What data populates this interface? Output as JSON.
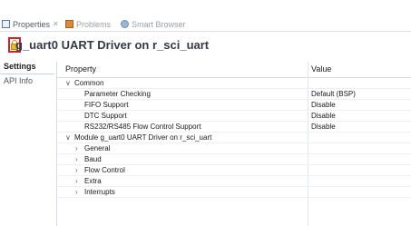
{
  "tabs": [
    {
      "label": "Properties",
      "icon": "properties-icon",
      "close": "✕",
      "active": true
    },
    {
      "label": "Problems",
      "icon": "problems-icon",
      "active": false
    },
    {
      "label": "Smart Browser",
      "icon": "smart-browser-icon",
      "active": false
    }
  ],
  "header": {
    "lock_icon": "lock-icon",
    "title": "g_uart0 UART Driver on r_sci_uart",
    "highlight_color": "#d0222b"
  },
  "side_tabs": [
    {
      "label": "Settings",
      "active": true
    },
    {
      "label": "API Info",
      "active": false
    }
  ],
  "grid": {
    "columns": {
      "property": "Property",
      "value": "Value"
    },
    "rows": [
      {
        "label": "Common",
        "value": "",
        "level": 0,
        "chevron": "∨"
      },
      {
        "label": "Parameter Checking",
        "value": "Default (BSP)",
        "level": 2,
        "chevron": ""
      },
      {
        "label": "FIFO Support",
        "value": "Disable",
        "level": 2,
        "chevron": ""
      },
      {
        "label": "DTC Support",
        "value": "Disable",
        "level": 2,
        "chevron": ""
      },
      {
        "label": "RS232/RS485 Flow Control Support",
        "value": "Disable",
        "level": 2,
        "chevron": ""
      },
      {
        "label": "Module g_uart0 UART Driver on r_sci_uart",
        "value": "",
        "level": 0,
        "chevron": "∨"
      },
      {
        "label": "General",
        "value": "",
        "level": 1,
        "chevron": "›"
      },
      {
        "label": "Baud",
        "value": "",
        "level": 1,
        "chevron": "›"
      },
      {
        "label": "Flow Control",
        "value": "",
        "level": 1,
        "chevron": "›"
      },
      {
        "label": "Extra",
        "value": "",
        "level": 1,
        "chevron": "›"
      },
      {
        "label": "Interrupts",
        "value": "",
        "level": 1,
        "chevron": "›"
      }
    ]
  }
}
